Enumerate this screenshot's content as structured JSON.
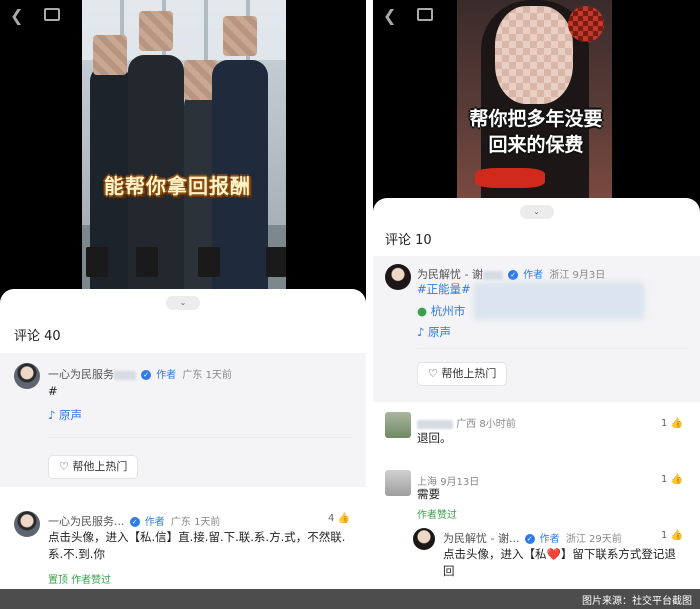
{
  "left": {
    "caption": "能帮你拿回报酬",
    "count": "评论 40",
    "c1": {
      "name": "一心为民服务",
      "tag": "作者",
      "region": "广东",
      "time": "1天前",
      "hash": "#",
      "audio": "原声",
      "promote": "帮他上热门"
    },
    "c2": {
      "name": "一心为民服务...",
      "tag": "作者",
      "region": "广东",
      "time": "1天前",
      "likes": "4",
      "text": "点击头像，进入【私.信】直.接.留.下.联.系.方.式，不然联.系.不.到.你",
      "pin": "置顶",
      "liked_by_author": "作者赞过"
    }
  },
  "right": {
    "caption": "帮你把多年没要回来的保费",
    "count": "评论 10",
    "c1": {
      "name": "为民解忧 - 谢",
      "tag": "作者",
      "region": "浙江",
      "time": "9月3日",
      "tags": "#正能量#",
      "location": "杭州市",
      "audio": "原声",
      "promote": "帮他上热门"
    },
    "c2": {
      "region": "广西",
      "time": "8小时前",
      "text": "退回。",
      "likes": "1"
    },
    "c3": {
      "region": "上海",
      "time": "9月13日",
      "text": "需要",
      "likes": "1",
      "liked_by_author": "作者赞过"
    },
    "c4": {
      "name": "为民解忧 - 谢...",
      "tag": "作者",
      "region": "浙江",
      "time": "29天前",
      "likes": "1",
      "text": "点击头像，进入【私❤️】留下联系方式登记退回"
    }
  },
  "footer": {
    "credit": "图片来源：社交平台截图"
  },
  "colors": {
    "accent": "#2f7ae5",
    "green": "#3aa14b",
    "footer_bg": "#4d4d4d"
  }
}
